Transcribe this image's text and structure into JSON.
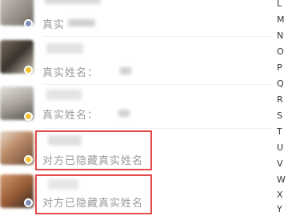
{
  "contacts": [
    {
      "label": "真实",
      "highlighted": false
    },
    {
      "label": "真实姓名：",
      "highlighted": false
    },
    {
      "label": "真实姓名：",
      "highlighted": false
    },
    {
      "label": "对方已隐藏真实姓名",
      "highlighted": true
    },
    {
      "label": "对方已隐藏真实姓名",
      "highlighted": true
    }
  ],
  "index_letters": [
    "L",
    "M",
    "N",
    "O",
    "P",
    "Q",
    "R",
    "S",
    "T",
    "U",
    "V",
    "W",
    "X",
    "Y"
  ],
  "colors": {
    "highlight_box": "#e24b4b",
    "label_gray": "#999999",
    "badge_gold": "#f1c232"
  }
}
